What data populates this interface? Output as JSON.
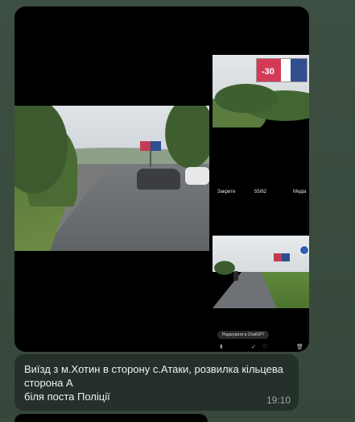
{
  "album": {
    "tile_count": 3,
    "viewer": {
      "close_label": "Закрити",
      "counter": "55/82",
      "media_label": "Медіа",
      "chatgpt_label": "Редагувати в ChatGPT"
    },
    "billboard_discount": "-30"
  },
  "message": {
    "caption_lines": [
      "Виїзд з  м.Хотин в сторону с.Атаки, розвилка кільцева",
      "сторона А",
      "біля поста Поліції"
    ],
    "time": "19:10"
  }
}
